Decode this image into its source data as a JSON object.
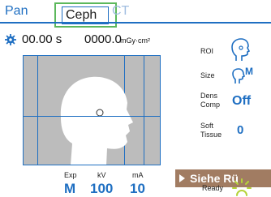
{
  "tabs": {
    "pan": "Pan",
    "ceph": "Ceph",
    "ct": "CT"
  },
  "readout": {
    "time": "00.00 s",
    "dose": "0000.0",
    "dose_unit": "mGy·cm²"
  },
  "exposure": {
    "exp_label": "Exp",
    "exp_value": "M",
    "kv_label": "kV",
    "kv_value": "100",
    "ma_label": "mA",
    "ma_value": "10"
  },
  "side": {
    "roi_label": "ROI",
    "size_label": "Size",
    "size_value": "M",
    "dens_label_1": "Dens",
    "dens_label_2": "Comp",
    "dens_value": "Off",
    "soft_label_1": "Soft",
    "soft_label_2": "Tissue",
    "soft_value": "0",
    "ready_label": "Ready"
  },
  "banner": {
    "text": "Siehe Rü"
  },
  "colors": {
    "accent": "#1f6fc2",
    "highlight": "#5cb85c",
    "banner": "#a17c62",
    "ready": "#b5d33a"
  },
  "icons": [
    "gear-icon",
    "roi-head-icon",
    "size-head-icon",
    "ready-icon",
    "arrow-right-icon"
  ]
}
